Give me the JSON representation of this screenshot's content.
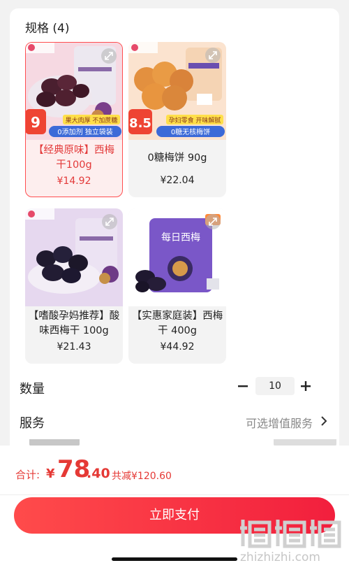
{
  "spec": {
    "title": "规格 (4)"
  },
  "products": [
    {
      "name": "【经典原味】西梅干100g",
      "price": "¥14.92",
      "selected": true,
      "badge_number": "9",
      "promo": [
        "果大肉厚 不加蔗糖",
        "0添加剂 独立袋装"
      ]
    },
    {
      "name": "0糖梅饼 90g",
      "price": "¥22.04",
      "selected": false,
      "badge_number": "8.5",
      "promo": [
        "孕妇零食 开味解腻",
        "0糖无核梅饼"
      ]
    },
    {
      "name": "【嗜酸孕妈推荐】酸味西梅干 100g",
      "price": "¥21.43",
      "selected": false
    },
    {
      "name": "【实惠家庭装】西梅干 400g",
      "price": "¥44.92",
      "selected": false,
      "pack_text": "每日西梅"
    }
  ],
  "quantity": {
    "label": "数量",
    "value": "10"
  },
  "service": {
    "label": "服务",
    "value": "可选增值服务"
  },
  "summary": {
    "total_label": "合计:",
    "currency": "¥",
    "amount_int": "78",
    "amount_dec": ".40",
    "discount": "共减¥120.60"
  },
  "pay_button": {
    "label": "立即支付"
  },
  "watermark": {
    "text": "zhizhizhi.com"
  },
  "colors": {
    "accent": "#f2263e",
    "selected_bg": "#fdeeee",
    "card_bg": "#f3f3f3"
  },
  "icons": {
    "expand": "expand-icon",
    "minus": "minus-icon",
    "plus": "plus-icon",
    "chevron": "chevron-right-icon"
  }
}
